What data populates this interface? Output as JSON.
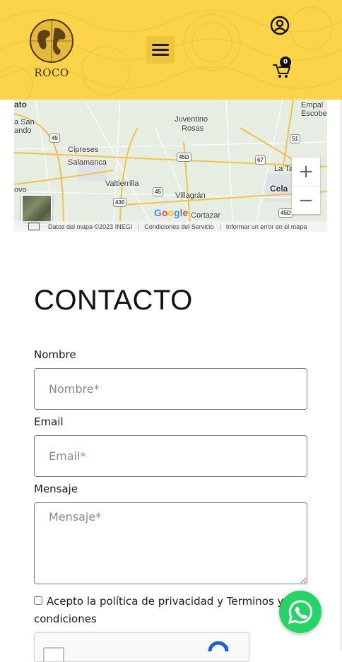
{
  "header": {
    "logo_text": "ROCO",
    "menu_icon": "hamburger-menu-icon",
    "account_icon": "user-circle-icon",
    "cart_icon": "shopping-cart-icon",
    "cart_count": "0",
    "background_color": "#fbd44a"
  },
  "map": {
    "labels": {
      "ato": "ato",
      "san": "a San",
      "ando": "ando",
      "juventino": "Juventino",
      "rosas": "Rosas",
      "empal": "Empal",
      "escobe": "Escobe",
      "cipreses": "Cipreses",
      "salamanca": "Salamanca",
      "la_t": "La Ta",
      "valtierrilla": "Valtierrilla",
      "villagran": "Villagrán",
      "cela": "Cela",
      "ovo": "ovo",
      "cortazar": "Cortazar"
    },
    "shields": {
      "s45a": "45",
      "s45b": "45",
      "s45d": "45D",
      "s45d2": "45D",
      "s51": "51",
      "s67": "67",
      "s430": "430"
    },
    "google_logo": "Google",
    "zoom_in": "+",
    "zoom_out": "−",
    "footer": {
      "data": "Datos del mapa ©2023 INEGI",
      "terms": "Condiciones del Servicio",
      "report": "Informar un error en el mapa"
    }
  },
  "contact": {
    "title": "CONTACTO",
    "name_label": "Nombre",
    "name_placeholder": "Nombre*",
    "email_label": "Email",
    "email_placeholder": "Email*",
    "message_label": "Mensaje",
    "message_placeholder": "Mensaje*",
    "consent_text": "Acepto la política de privacidad y Terminos y condiciones"
  },
  "whatsapp": {
    "icon": "whatsapp-icon",
    "color": "#25d366"
  }
}
